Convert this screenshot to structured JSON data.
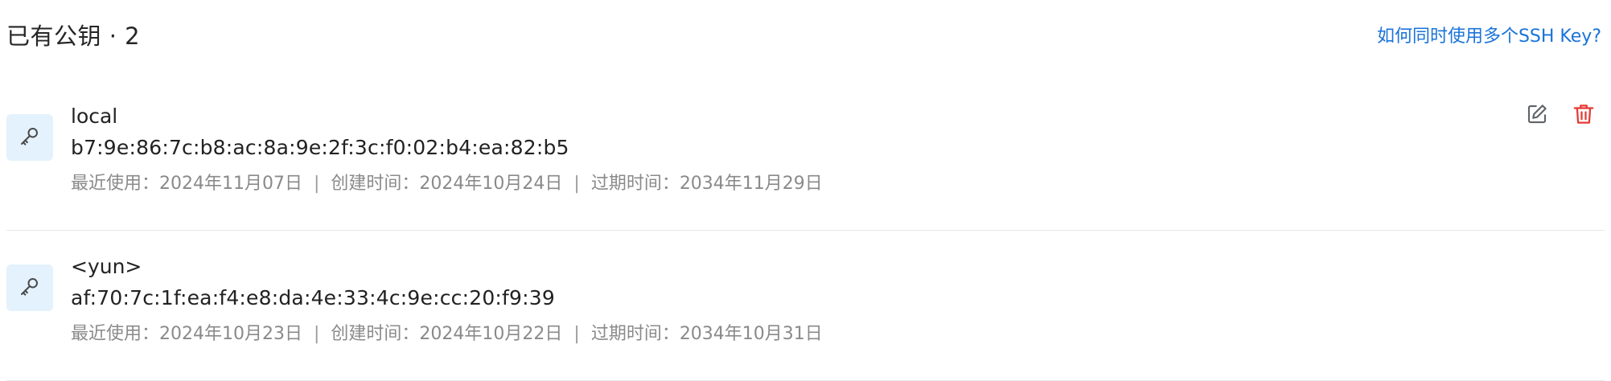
{
  "header": {
    "title": "已有公钥 · 2",
    "help_link": "如何同时使用多个SSH Key?"
  },
  "colors": {
    "link": "#1a73d9",
    "delete": "#e53935",
    "edit": "#5f6368",
    "badge_bg": "#e3f2fc"
  },
  "keys": [
    {
      "name": "local",
      "fingerprint": "b7:9e:86:7c:b8:ac:8a:9e:2f:3c:f0:02:b4:ea:82:b5",
      "last_used": "最近使用：2024年11月07日",
      "created": "创建时间：2024年10月24日",
      "expires": "过期时间：2034年11月29日",
      "separator": "|",
      "icon": "key-icon"
    },
    {
      "name": "<yun>",
      "fingerprint": "af:70:7c:1f:ea:f4:e8:da:4e:33:4c:9e:cc:20:f9:39",
      "last_used": "最近使用：2024年10月23日",
      "created": "创建时间：2024年10月22日",
      "expires": "过期时间：2034年10月31日",
      "separator": "|",
      "icon": "key-icon"
    }
  ],
  "actions": {
    "edit_icon": "edit-icon",
    "delete_icon": "trash-icon"
  }
}
